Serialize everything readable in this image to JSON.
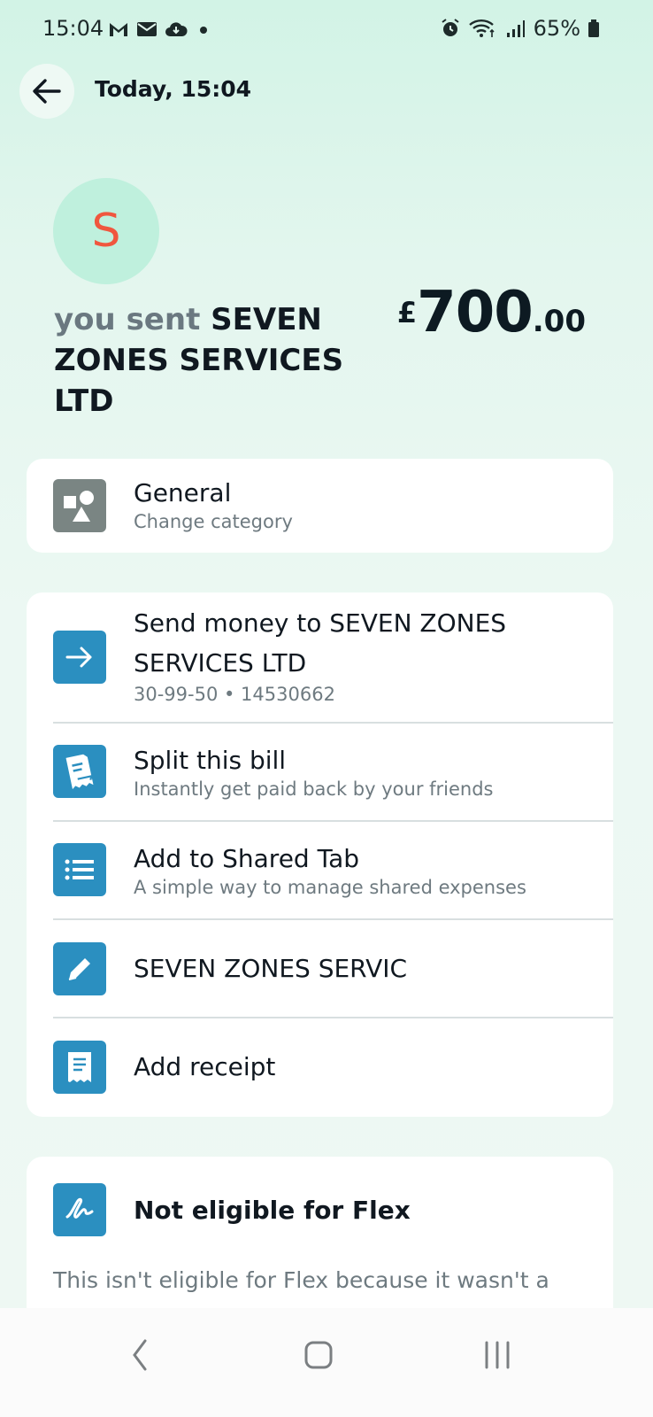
{
  "status_bar": {
    "time": "15:04",
    "battery": "65%",
    "left_icons": [
      "gmail-icon",
      "mail-icon",
      "cloud-icon",
      "dot-icon"
    ],
    "right_icons": [
      "alarm-icon",
      "wifi-icon",
      "signal-icon",
      "battery-icon"
    ]
  },
  "header": {
    "title": "Today, 15:04"
  },
  "transaction": {
    "avatar_letter": "S",
    "prefix": "you sent",
    "payee": "SEVEN ZONES SERVICES LTD",
    "amount_currency": "£",
    "amount_major": "700",
    "amount_minor": ".00"
  },
  "category": {
    "title": "General",
    "subtitle": "Change category"
  },
  "actions": [
    {
      "title": "Send money to SEVEN ZONES SERVICES LTD",
      "subtitle": "30-99-50 • 14530662",
      "icon": "arrow-right-icon"
    },
    {
      "title": "Split this bill",
      "subtitle": "Instantly get paid back by your friends",
      "icon": "split-bill-icon"
    },
    {
      "title": "Add to Shared Tab",
      "subtitle": "A simple way to manage shared expenses",
      "icon": "list-icon"
    },
    {
      "title": "SEVEN ZONES SERVIC",
      "subtitle": "",
      "icon": "pencil-icon"
    },
    {
      "title": "Add receipt",
      "subtitle": "",
      "icon": "receipt-icon"
    }
  ],
  "flex": {
    "title": "Not eligible for Flex",
    "description": "This isn't eligible for Flex because it wasn't a card payment"
  },
  "colors": {
    "accent_blue": "#2b8fc0",
    "avatar_bg": "#bff0dd",
    "avatar_letter": "#f0563e",
    "category_icon": "#7a8583"
  }
}
